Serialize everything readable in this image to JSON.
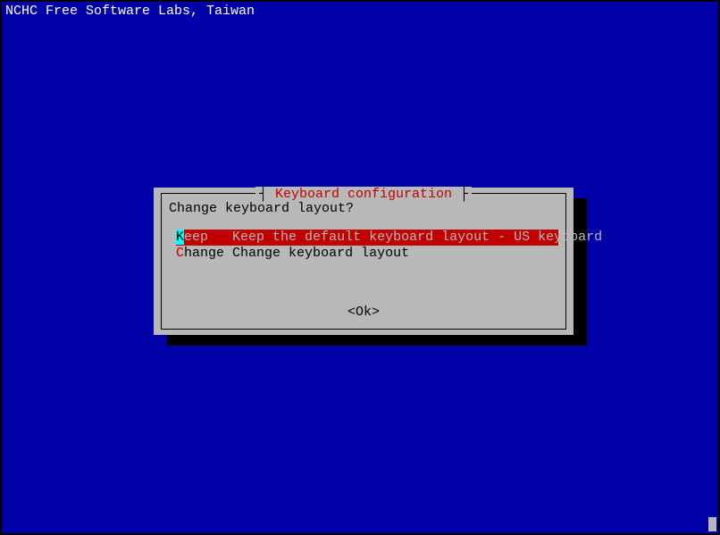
{
  "header": {
    "title": "NCHC Free Software Labs, Taiwan"
  },
  "dialog": {
    "title": " Keyboard configuration ",
    "prompt": "Change keyboard layout?",
    "menu": {
      "items": [
        {
          "hotkey": "K",
          "rest_key": "eep",
          "padding": "   ",
          "desc": "Keep the default keyboard layout - US keyboard",
          "selected": true
        },
        {
          "hotkey": "C",
          "rest_key": "hange",
          "padding": " ",
          "desc": "Change keyboard layout",
          "selected": false
        }
      ]
    },
    "button": {
      "label": "<Ok>"
    }
  }
}
